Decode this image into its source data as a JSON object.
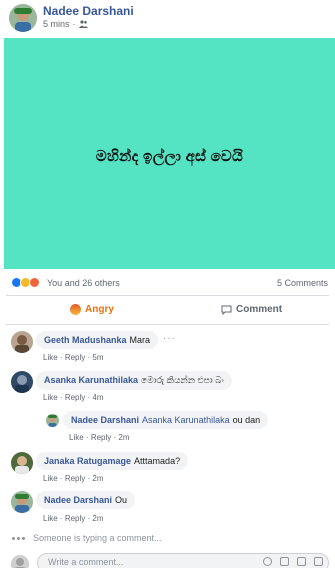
{
  "post": {
    "author": "Nadee Darshani",
    "time": "5 mins",
    "audience_icon": "friends-icon",
    "text": "මහින්ද ඉල්ලා අස් වෙයි",
    "background_color": "#54e3c3"
  },
  "reactions": {
    "icons": [
      "like",
      "haha",
      "angry"
    ],
    "summary": "You and 26 others",
    "comments_count": "5 Comments"
  },
  "actions": {
    "reaction_label": "Angry",
    "comment_label": "Comment"
  },
  "comments": [
    {
      "name": "Geeth Madushanka",
      "text": "Mara",
      "like": "Like",
      "reply": "Reply",
      "time": "5m"
    },
    {
      "name": "Asanka Karunathilaka",
      "text": "මොරු කියන්න එපා බං",
      "like": "Like",
      "reply": "Reply",
      "time": "4m"
    },
    {
      "name": "Nadee Darshani",
      "tag": "Asanka Karunathilaka",
      "text": "ou dan",
      "like": "Like",
      "reply": "Reply",
      "time": "2m"
    },
    {
      "name": "Janaka Ratugamage",
      "text": "Atttamada?",
      "like": "Like",
      "reply": "Reply",
      "time": "2m"
    },
    {
      "name": "Nadee Darshani",
      "text": "Ou",
      "like": "Like",
      "reply": "Reply",
      "time": "2m"
    }
  ],
  "typing": {
    "text": "Someone is typing a comment..."
  },
  "composer": {
    "placeholder": "Write a comment..."
  },
  "separator": "·"
}
